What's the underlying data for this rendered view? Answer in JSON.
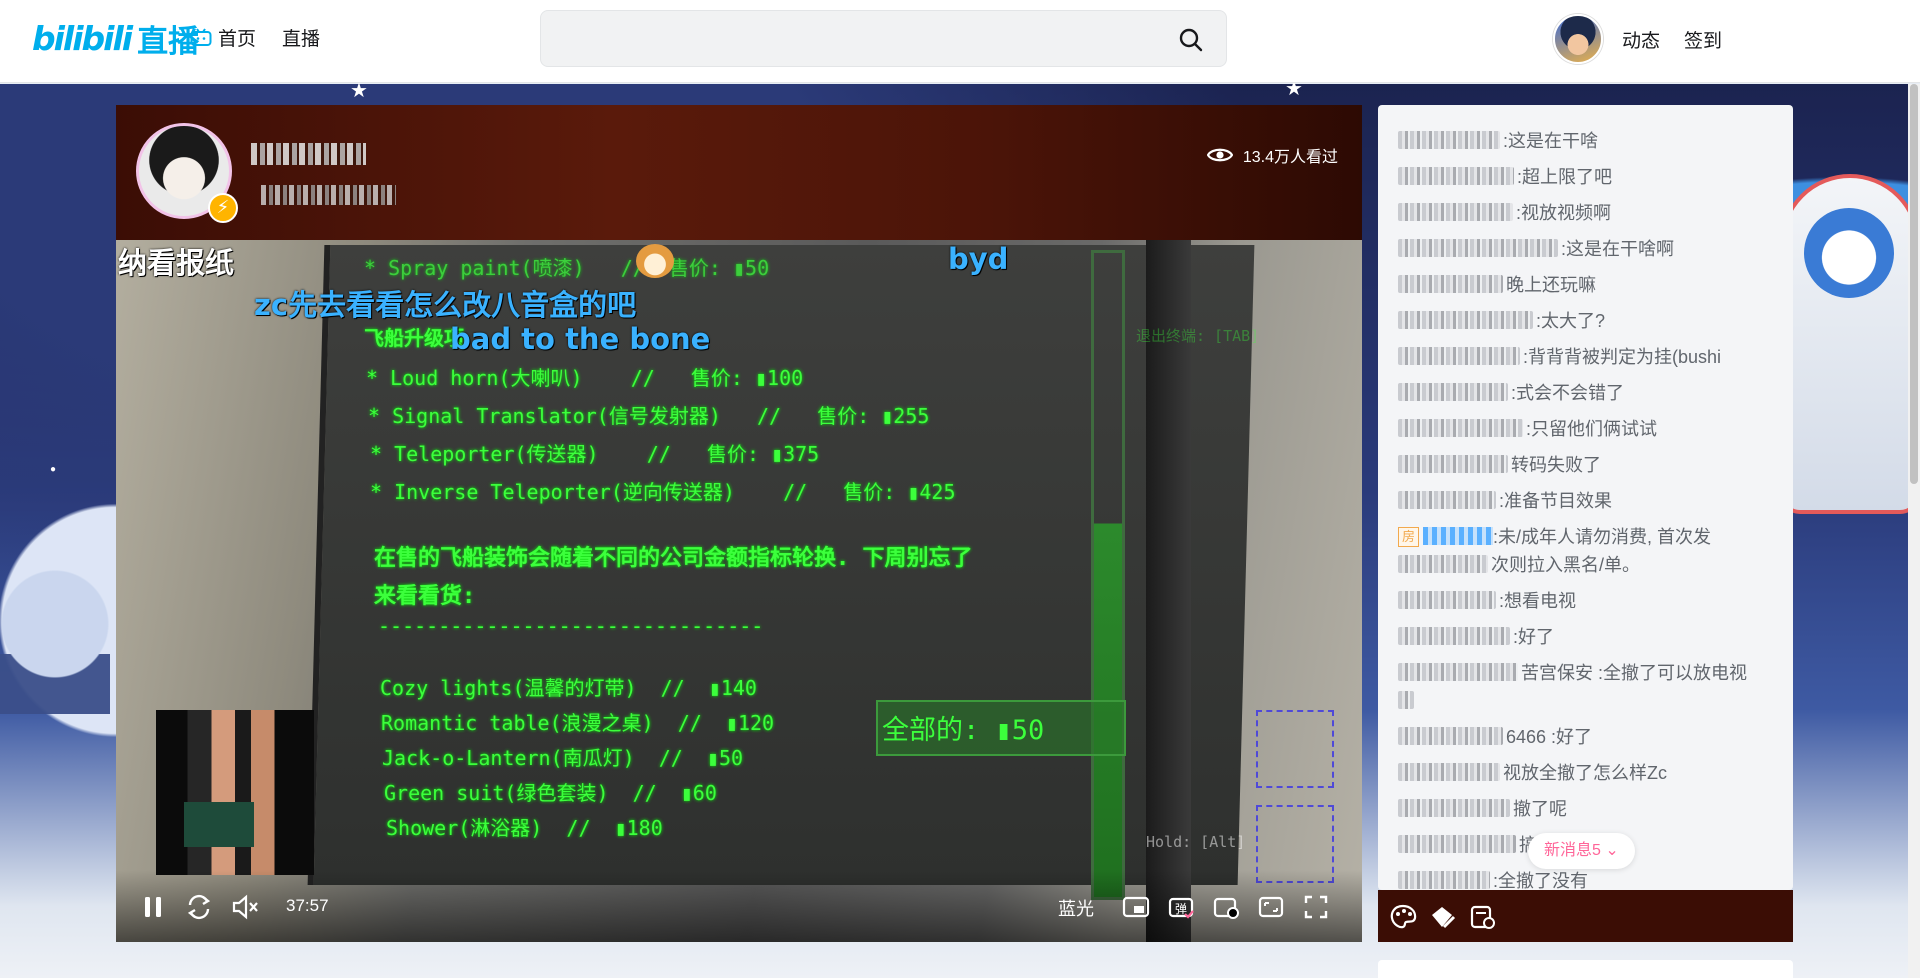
{
  "header": {
    "logo_text": "bilibili",
    "logo_live": "直播",
    "nav": [
      {
        "label": "首页",
        "icon": "tv-icon"
      },
      {
        "label": "直播"
      }
    ],
    "search": {
      "value": "",
      "placeholder": ""
    },
    "user_links": [
      "动态",
      "签到"
    ]
  },
  "player": {
    "viewers": "13.4万人看过",
    "time": "37:57",
    "quality": "蓝光",
    "danmaku": [
      "纳看报纸",
      "zc先去看看怎么改八音盒的吧",
      "bad to the bone",
      "byd"
    ],
    "terminal": [
      "* Spray paint(喷漆)   //  售价: ▮50",
      "飞船升级项",
      "* Loud horn(大喇叭)    //   售价: ▮100",
      "* Signal Translator(信号发射器)   //   售价: ▮255",
      "* Teleporter(传送器)    //   售价: ▮375",
      "* Inverse Teleporter(逆向传送器)    //   售价: ▮425",
      "在售的飞船装饰会随着不同的公司金额指标轮换. 下周别忘了",
      "来看看货:",
      "--------------------------------",
      "Cozy lights(温馨的灯带)  //  ▮140",
      "Romantic table(浪漫之桌)  //  ▮120",
      "Jack-o-Lantern(南瓜灯)  //  ▮50",
      "Green suit(绿色套装)  //  ▮60",
      "Shower(淋浴器)  //  ▮180"
    ],
    "total": "全部的: ▮50",
    "hud_exit": "退出终端: [TAB]",
    "hud_hold": "Hold: [Alt]"
  },
  "chat": {
    "messages": [
      {
        "text": ":这是在干啥"
      },
      {
        "text": ":超上限了吧"
      },
      {
        "text": ":视放视频啊"
      },
      {
        "text": ":这是在干啥啊"
      },
      {
        "text": "晚上还玩嘛"
      },
      {
        "text": ":太大了?"
      },
      {
        "text": ":背背背被判定为挂(bushi"
      },
      {
        "text": ":式会不会错了"
      },
      {
        "text": ":只留他们俩试试"
      },
      {
        "text": "转码失败了"
      },
      {
        "text": ":准备节目效果"
      },
      {
        "text": ":未/成年人请勿消费, 首次发",
        "text2": "次则拉入黑名/单。",
        "tag": "房"
      },
      {
        "text": ":想看电视"
      },
      {
        "text": ":好了"
      },
      {
        "text": "苦宫保安 :全撤了可以放电视",
        "text2": ""
      },
      {
        "text": "6466 :好了"
      },
      {
        "text": "视放全撤了怎么样Zc"
      },
      {
        "text": "撤了呢"
      },
      {
        "text": "搞电视"
      },
      {
        "text": ":全撤了没有"
      }
    ],
    "new_messages": "新消息5 ⌄"
  }
}
